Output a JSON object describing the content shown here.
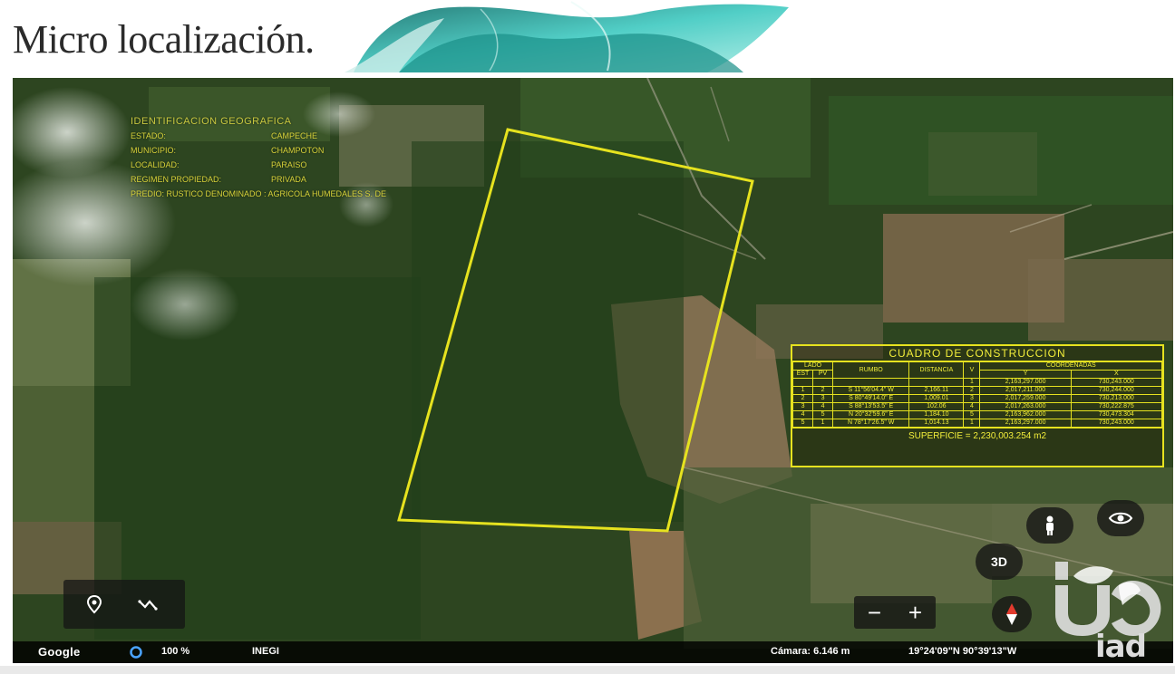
{
  "header": {
    "title": "Micro localización."
  },
  "identification": {
    "title": "IDENTIFICACION GEOGRAFICA",
    "rows": [
      {
        "key": "ESTADO:",
        "value": "CAMPECHE"
      },
      {
        "key": "MUNICIPIO:",
        "value": "CHAMPOTON"
      },
      {
        "key": "LOCALIDAD:",
        "value": "PARAISO"
      },
      {
        "key": "REGIMEN PROPIEDAD:",
        "value": "PRIVADA"
      }
    ],
    "predio": "PREDIO: RUSTICO DENOMINADO : AGRICOLA HUMEDALES S. DE"
  },
  "cuadro": {
    "title": "CUADRO DE CONSTRUCCION",
    "headers": {
      "lado": "LADO",
      "est": "EST",
      "pv": "PV",
      "rumbo": "RUMBO",
      "distancia": "DISTANCIA",
      "v": "V",
      "coordenadas": "COORDENADAS",
      "y": "Y",
      "x": "X"
    },
    "rows": [
      {
        "est": "",
        "pv": "",
        "rumbo": "",
        "distancia": "",
        "v": "1",
        "y": "2,163,297.000",
        "x": "730,243.000"
      },
      {
        "est": "1",
        "pv": "2",
        "rumbo": "S 11°56'04.4\" W",
        "distancia": "2,166.11",
        "v": "2",
        "y": "2,017,211.000",
        "x": "730,244.000"
      },
      {
        "est": "2",
        "pv": "3",
        "rumbo": "S 80°49'14.0\" E",
        "distancia": "1,009.01",
        "v": "3",
        "y": "2,017,259.000",
        "x": "730,213.000"
      },
      {
        "est": "3",
        "pv": "4",
        "rumbo": "S 88°13'53.5\" E",
        "distancia": "102.06",
        "v": "4",
        "y": "2,017,263.000",
        "x": "730,222.875"
      },
      {
        "est": "4",
        "pv": "5",
        "rumbo": "N 20°32'59.6\" E",
        "distancia": "1,184.10",
        "v": "5",
        "y": "2,163,962.000",
        "x": "730,473.304"
      },
      {
        "est": "5",
        "pv": "1",
        "rumbo": "N 78°17'26.5\" W",
        "distancia": "1,014.13",
        "v": "1",
        "y": "2,163,297.000",
        "x": "730,243.000"
      }
    ],
    "superficie": "SUPERFICIE = 2,230,003.254 m2"
  },
  "controls": {
    "btn_3d": "3D",
    "zoom_out": "−",
    "zoom_in": "+"
  },
  "statusbar": {
    "logo": "Google",
    "zoom": "100 %",
    "provider": "INEGI",
    "camera": "Cámara: 6.146 m",
    "coords": "19°24'09\"N 90°39'13\"W"
  },
  "watermark": {
    "text": "iad"
  },
  "colors": {
    "boundary": "#e6e21f",
    "label_text": "#d8d33a"
  }
}
